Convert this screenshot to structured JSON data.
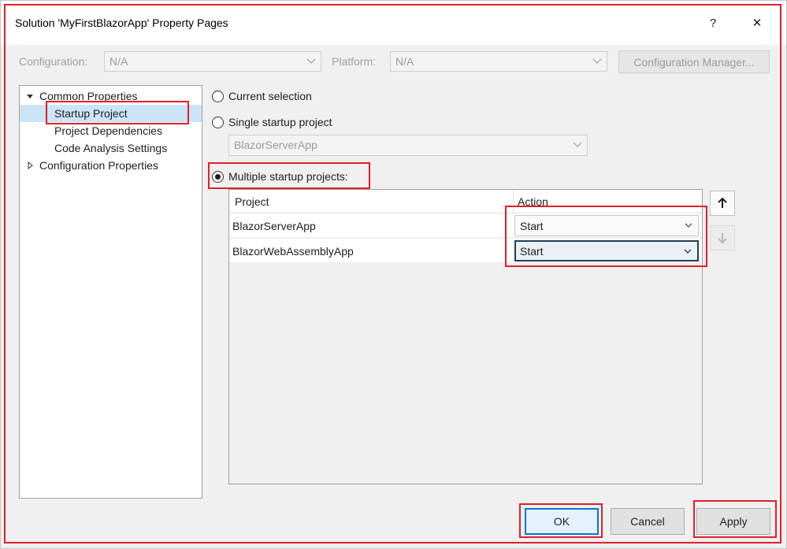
{
  "window": {
    "title": "Solution 'MyFirstBlazorApp' Property Pages",
    "help_label": "?",
    "close_label": "✕"
  },
  "config_bar": {
    "configuration_label": "Configuration:",
    "configuration_value": "N/A",
    "platform_label": "Platform:",
    "platform_value": "N/A",
    "manager_button_label": "Configuration Manager..."
  },
  "tree": {
    "common_properties": "Common Properties",
    "items": [
      "Startup Project",
      "Project Dependencies",
      "Code Analysis Settings"
    ],
    "selected_index": 0,
    "configuration_properties": "Configuration Properties"
  },
  "startup": {
    "current_selection_label": "Current selection",
    "single_startup_label": "Single startup project",
    "single_startup_value": "BlazorServerApp",
    "multiple_startup_label": "Multiple startup projects:",
    "selected_option": "multiple"
  },
  "projects_grid": {
    "columns": [
      "Project",
      "Action"
    ],
    "rows": [
      {
        "project": "BlazorServerApp",
        "action": "Start"
      },
      {
        "project": "BlazorWebAssemblyApp",
        "action": "Start"
      }
    ]
  },
  "buttons": {
    "ok": "OK",
    "cancel": "Cancel",
    "apply": "Apply"
  },
  "colors": {
    "highlight": "#e0202a",
    "selection": "#cce4f7",
    "accent": "#0078d7"
  }
}
